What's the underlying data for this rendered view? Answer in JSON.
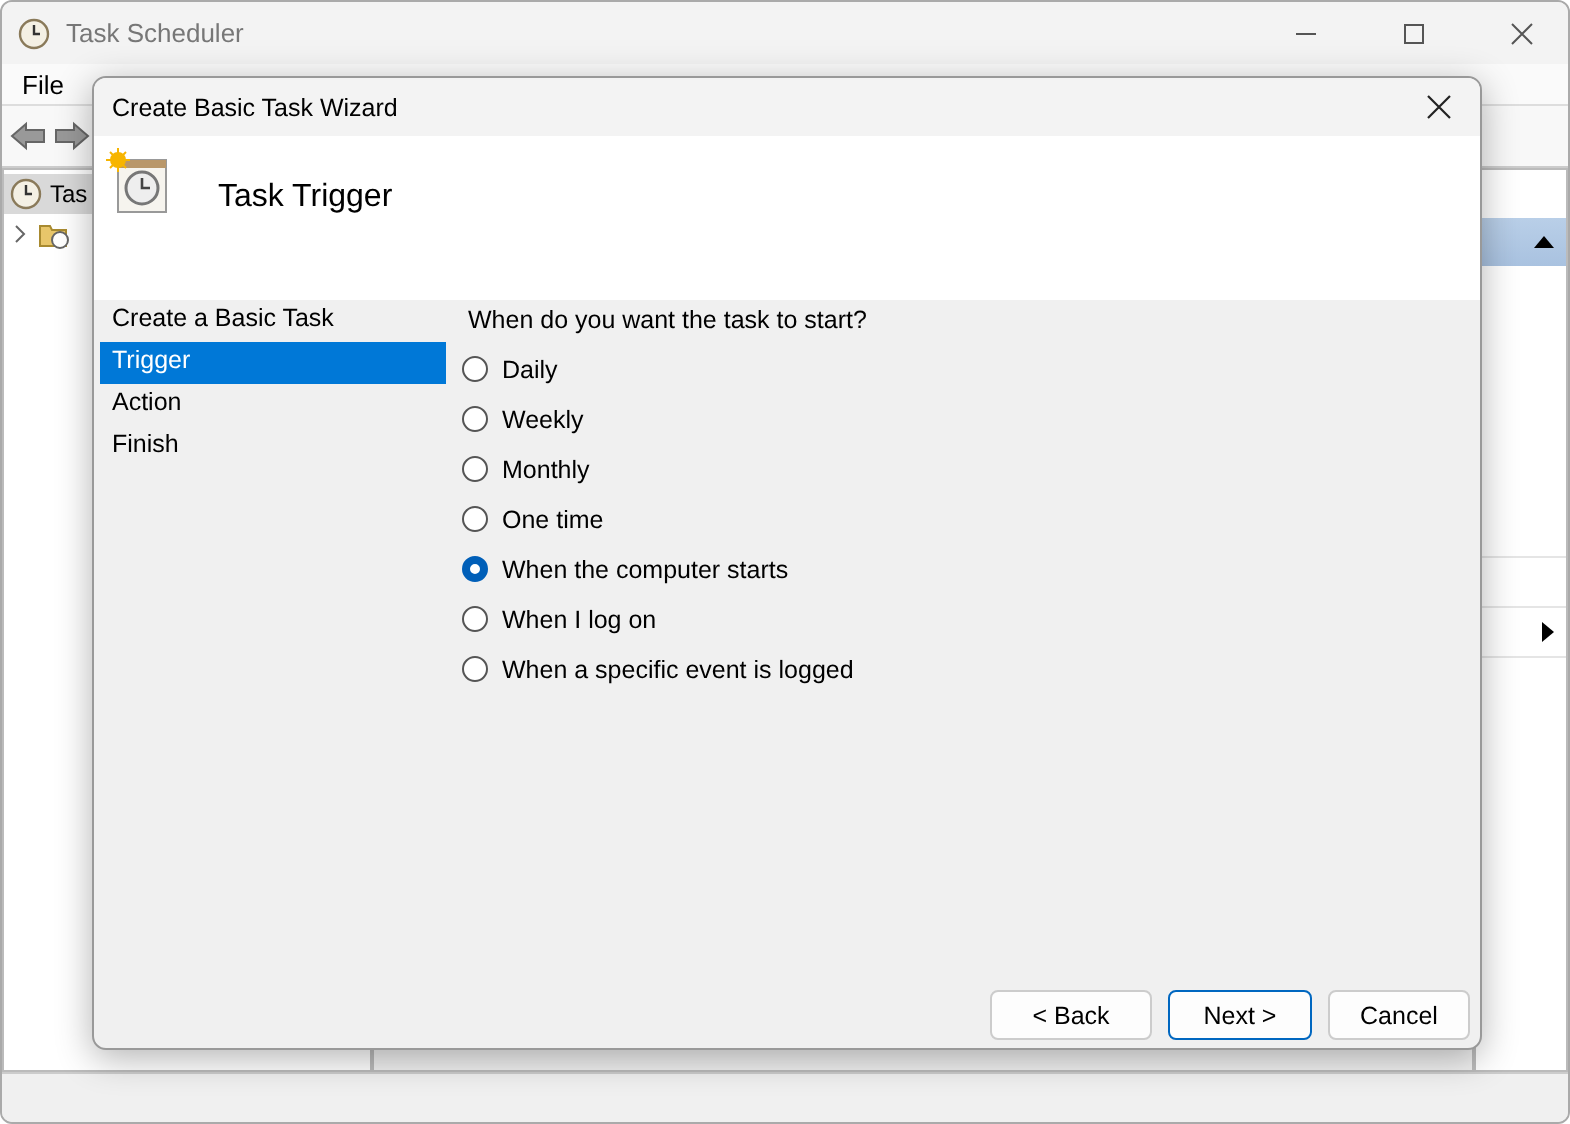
{
  "window": {
    "title": "Task Scheduler"
  },
  "menu": [
    "File"
  ],
  "tree": [
    {
      "label": "Tas",
      "selected": true
    }
  ],
  "dialog": {
    "title": "Create Basic Task Wizard",
    "heading": "Task Trigger",
    "steps": [
      {
        "label": "Create a Basic Task",
        "selected": false
      },
      {
        "label": "Trigger",
        "selected": true
      },
      {
        "label": "Action",
        "selected": false
      },
      {
        "label": "Finish",
        "selected": false
      }
    ],
    "question": "When do you want the task to start?",
    "options": [
      {
        "label": "Daily",
        "selected": false
      },
      {
        "label": "Weekly",
        "selected": false
      },
      {
        "label": "Monthly",
        "selected": false
      },
      {
        "label": "One time",
        "selected": false
      },
      {
        "label": "When the computer starts",
        "selected": true
      },
      {
        "label": "When I log on",
        "selected": false
      },
      {
        "label": "When a specific event is logged",
        "selected": false
      }
    ],
    "buttons": [
      {
        "label": "< Back",
        "default": false
      },
      {
        "label": "Next >",
        "default": true
      },
      {
        "label": "Cancel",
        "default": false
      }
    ]
  }
}
